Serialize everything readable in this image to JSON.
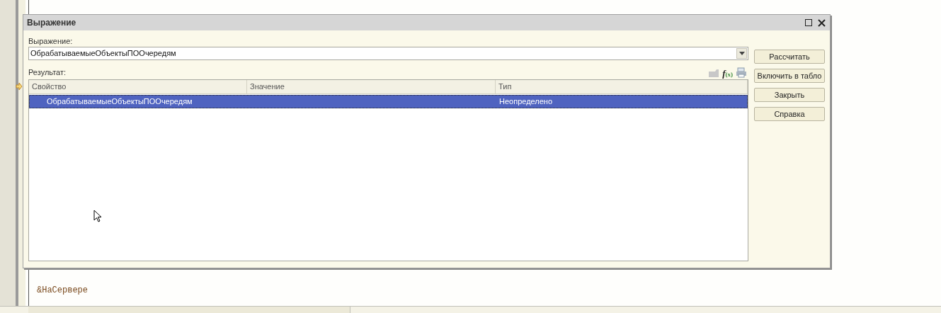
{
  "dialog": {
    "title": "Выражение",
    "expression_label": "Выражение:",
    "expression": {
      "value": "ОбрабатываемыеОбъектыПООчередям"
    },
    "result_label": "Результат:",
    "function_button": {
      "symbol": "f",
      "argument": "(x)"
    },
    "table": {
      "columns": [
        "Свойство",
        "Значение",
        "Тип"
      ],
      "rows": [
        {
          "property": "ОбрабатываемыеОбъектыПООчередям",
          "type": "Неопределено",
          "selected": true
        }
      ]
    },
    "buttons": [
      "Рассчитать",
      "Включить в табло",
      "Закрыть",
      "Справка"
    ]
  },
  "editor": {
    "lines": [
      "&НаСервере"
    ]
  }
}
